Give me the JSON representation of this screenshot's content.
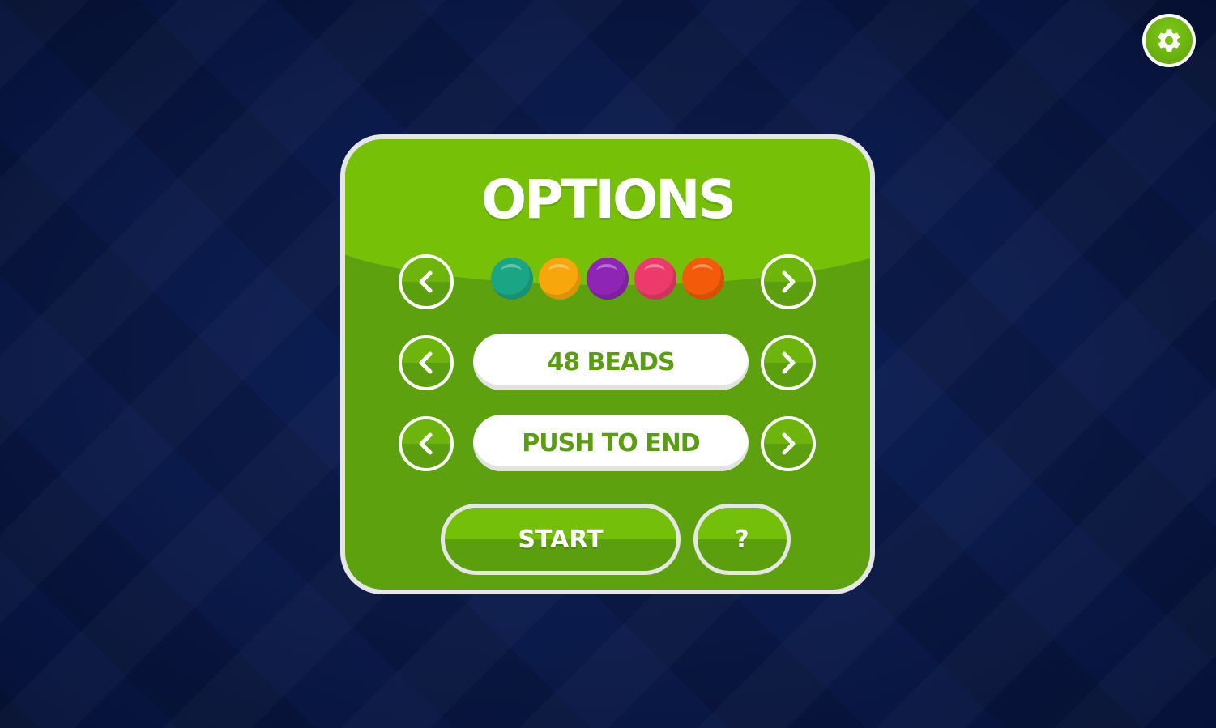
{
  "settings": {
    "icon": "gear-icon"
  },
  "panel": {
    "title": "OPTIONS",
    "colors_row": {
      "beads": [
        {
          "color": "#1aa584"
        },
        {
          "color": "#f7a70c"
        },
        {
          "color": "#8e25b5"
        },
        {
          "color": "#ec3b6a"
        },
        {
          "color": "#f35a0a"
        }
      ]
    },
    "beads_row": {
      "value": "48 BEADS"
    },
    "mode_row": {
      "value": "PUSH TO END"
    },
    "start_label": "START",
    "help_label": "?"
  },
  "colors": {
    "panel_green": "#5ea10f",
    "panel_light_green": "#76c108",
    "text_green": "#5a9d10",
    "background": "#0a1a4a"
  }
}
